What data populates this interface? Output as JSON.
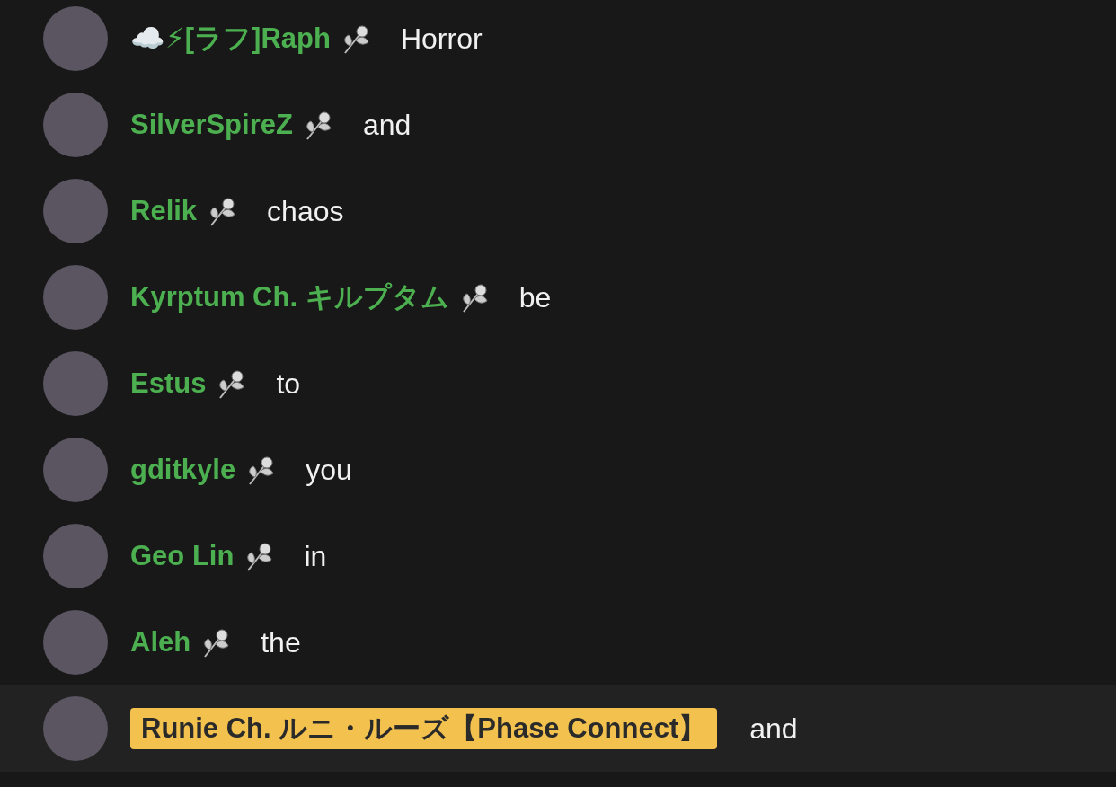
{
  "messages": [
    {
      "author": "☁️⚡[ラフ]Raph",
      "member": true,
      "highlighted": false,
      "text": "Horror"
    },
    {
      "author": "SilverSpireZ",
      "member": true,
      "highlighted": false,
      "text": "and"
    },
    {
      "author": "Relik",
      "member": true,
      "highlighted": false,
      "text": "chaos"
    },
    {
      "author": "Kyrptum Ch. キルプタム",
      "member": true,
      "highlighted": false,
      "text": "be"
    },
    {
      "author": "Estus",
      "member": true,
      "highlighted": false,
      "text": "to"
    },
    {
      "author": "gditkyle",
      "member": true,
      "highlighted": false,
      "text": "you"
    },
    {
      "author": "Geo Lin",
      "member": true,
      "highlighted": false,
      "text": "in"
    },
    {
      "author": "Aleh",
      "member": true,
      "highlighted": false,
      "text": "the"
    },
    {
      "author": "Runie Ch. ルニ・ルーズ【Phase Connect】",
      "member": false,
      "highlighted": true,
      "text": "and"
    }
  ]
}
